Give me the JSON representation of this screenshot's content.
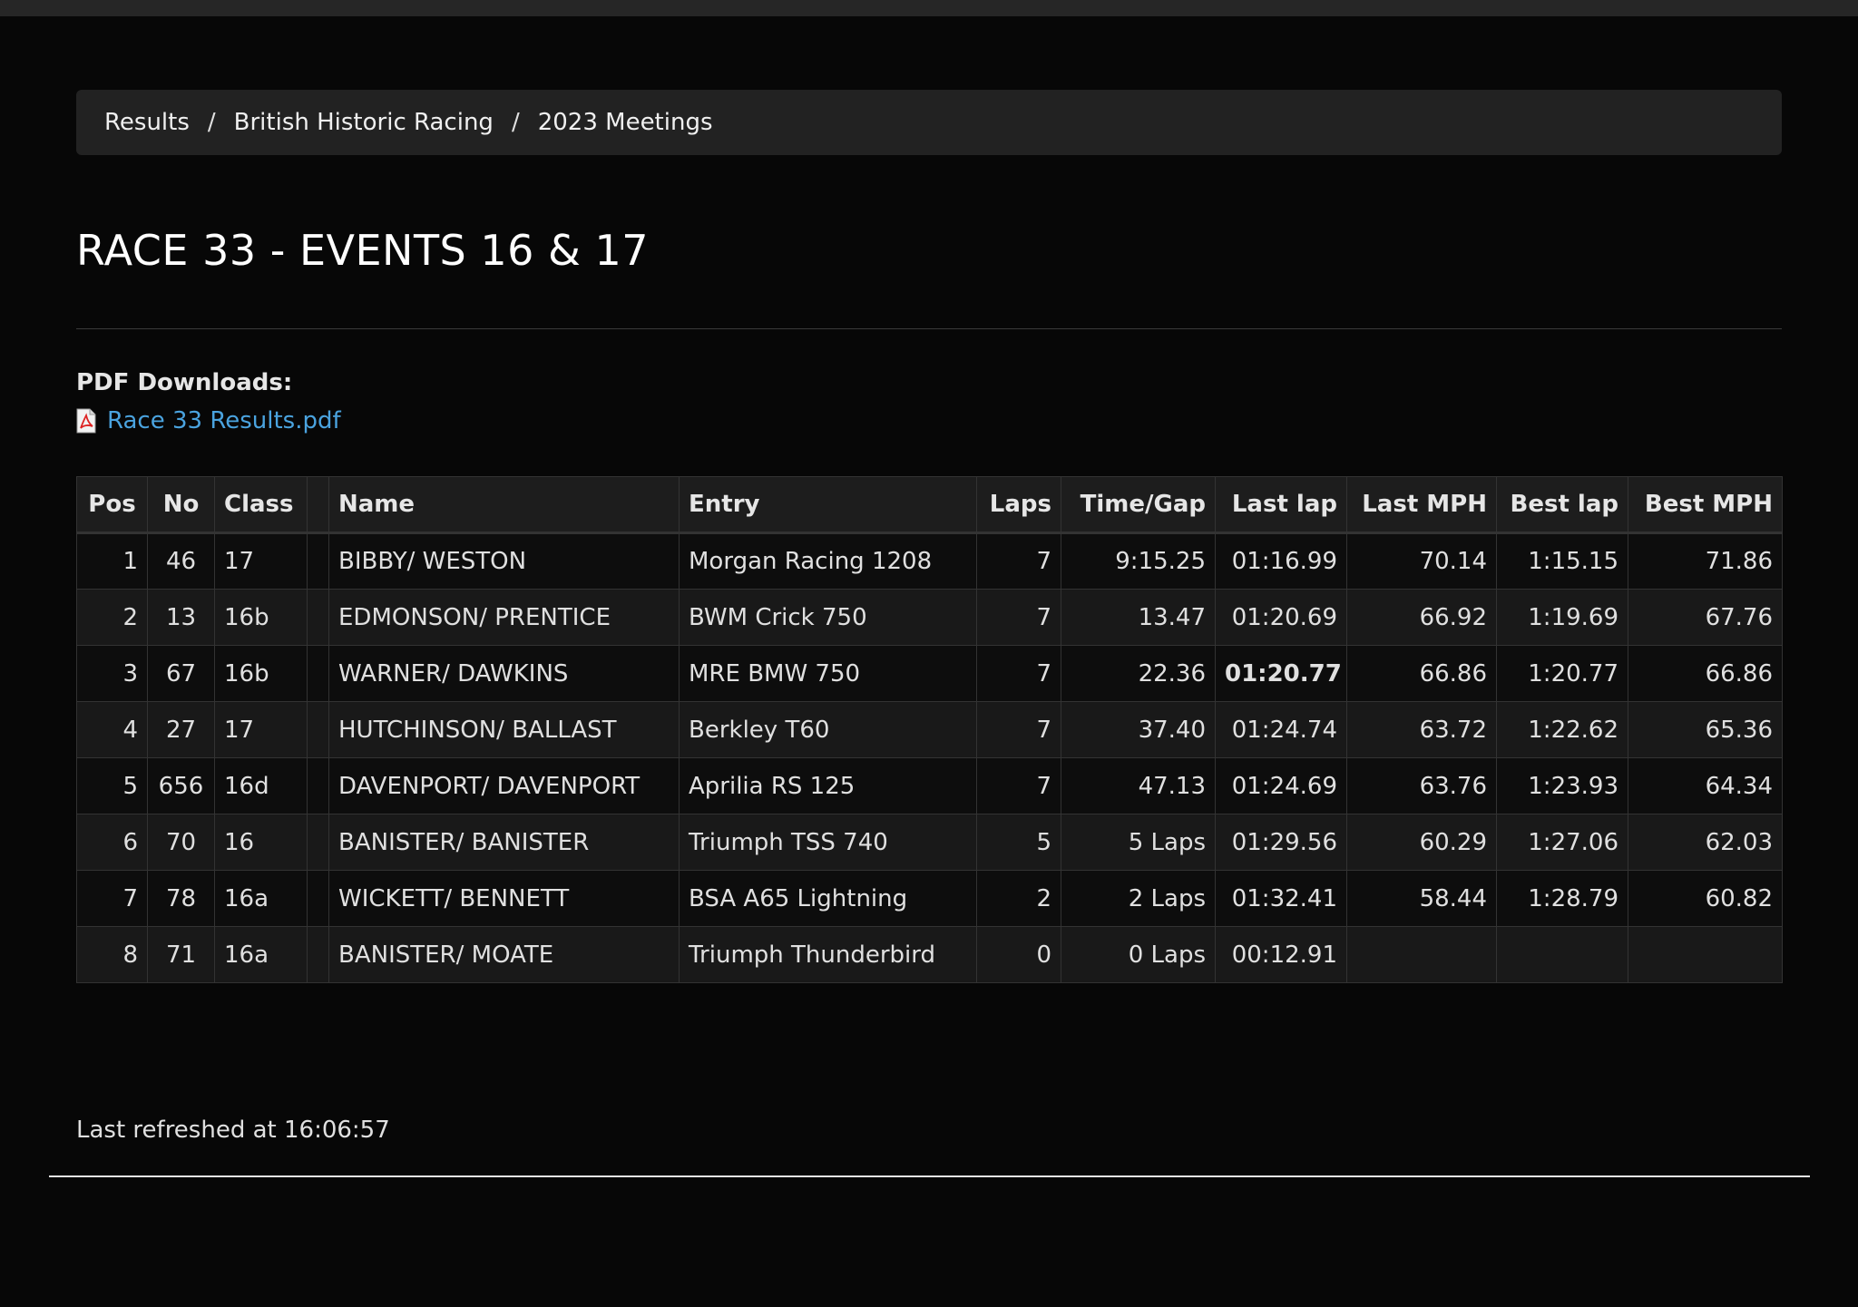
{
  "breadcrumb": {
    "items": [
      "Results",
      "British Historic Racing",
      "2023 Meetings"
    ],
    "separator": "/"
  },
  "page": {
    "title": "RACE 33 - EVENTS 16 & 17"
  },
  "downloads": {
    "label": "PDF Downloads:",
    "file_label": "Race 33 Results.pdf",
    "icon": "pdf-file-icon"
  },
  "table": {
    "columns": [
      "Pos",
      "No",
      "Class",
      "",
      "Name",
      "Entry",
      "Laps",
      "Time/Gap",
      "Last lap",
      "Last MPH",
      "Best lap",
      "Best MPH"
    ],
    "rows": [
      [
        "1",
        "46",
        "17",
        "",
        "BIBBY/ WESTON",
        "Morgan Racing 1208",
        "7",
        "9:15.25",
        "01:16.99",
        "70.14",
        "1:15.15",
        "71.86"
      ],
      [
        "2",
        "13",
        "16b",
        "",
        "EDMONSON/ PRENTICE",
        "BWM Crick 750",
        "7",
        "13.47",
        "01:20.69",
        "66.92",
        "1:19.69",
        "67.76"
      ],
      [
        "3",
        "67",
        "16b",
        "",
        "WARNER/ DAWKINS",
        "MRE BMW 750",
        "7",
        "22.36",
        "01:20.77",
        "66.86",
        "1:20.77",
        "66.86"
      ],
      [
        "4",
        "27",
        "17",
        "",
        "HUTCHINSON/ BALLAST",
        "Berkley T60",
        "7",
        "37.40",
        "01:24.74",
        "63.72",
        "1:22.62",
        "65.36"
      ],
      [
        "5",
        "656",
        "16d",
        "",
        "DAVENPORT/ DAVENPORT",
        "Aprilia RS 125",
        "7",
        "47.13",
        "01:24.69",
        "63.76",
        "1:23.93",
        "64.34"
      ],
      [
        "6",
        "70",
        "16",
        "",
        "BANISTER/ BANISTER",
        "Triumph TSS 740",
        "5",
        "5 Laps",
        "01:29.56",
        "60.29",
        "1:27.06",
        "62.03"
      ],
      [
        "7",
        "78",
        "16a",
        "",
        "WICKETT/ BENNETT",
        "BSA A65 Lightning",
        "2",
        "2 Laps",
        "01:32.41",
        "58.44",
        "1:28.79",
        "60.82"
      ],
      [
        "8",
        "71",
        "16a",
        "",
        "BANISTER/ MOATE",
        "Triumph Thunderbird",
        "0",
        "0 Laps",
        "00:12.91",
        "",
        "",
        ""
      ]
    ],
    "highlights": {
      "best_overall_lap_color": "#d63ad6",
      "fastest_last_lap_color": "#4cd43c"
    }
  },
  "status": {
    "refreshed": "Last refreshed at 16:06:57"
  },
  "colors": {
    "background": "#070707",
    "link": "#4aa3df"
  }
}
